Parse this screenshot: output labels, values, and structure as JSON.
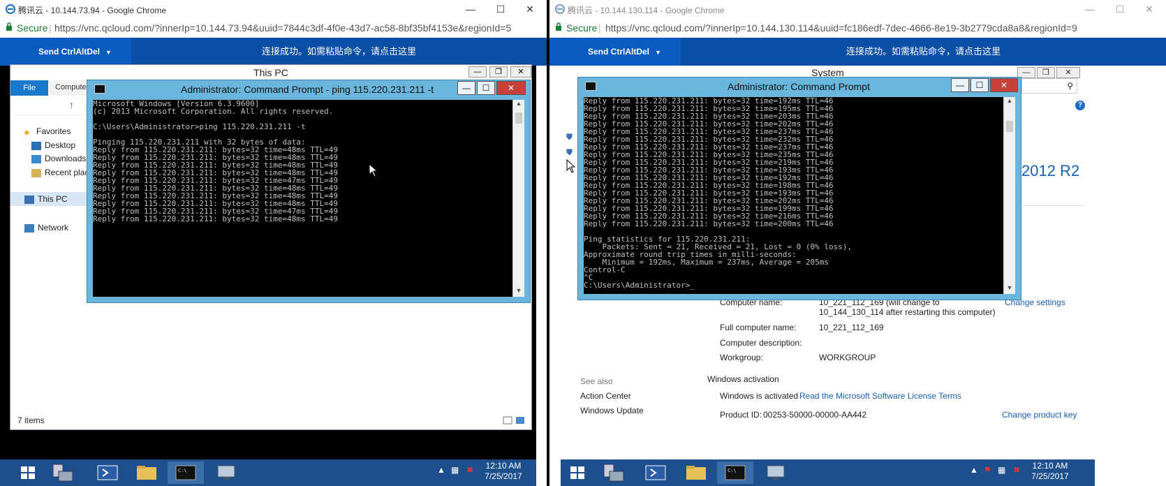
{
  "left": {
    "chrome_title": "腾讯云 - 10.144.73.94 - Google Chrome",
    "secure": "Secure",
    "url": "https://vnc.qcloud.com/?innerIp=10.144.73.94&uuid=7844c3df-4f0e-43d7-ac58-8bf35bf4153e&regionId=5",
    "send_ctrl": "Send CtrlAltDel",
    "notice": "连接成功。如需粘贴命令，请点击这里",
    "explorer": {
      "title": "This PC",
      "tab_file": "File",
      "tab_computer": "Computer",
      "nav_items": [
        "Favorites",
        "Desktop",
        "Downloads",
        "Recent places",
        "This PC",
        "Network"
      ],
      "status": "7 items"
    },
    "cmd": {
      "title": "Administrator: Command Prompt - ping  115.220.231.211 -t",
      "lines": [
        "Microsoft Windows [Version 6.3.9600]",
        "(c) 2013 Microsoft Corporation. All rights reserved.",
        "",
        "C:\\Users\\Administrator>ping 115.220.231.211 -t",
        "",
        "Pinging 115.220.231.211 with 32 bytes of data:",
        "Reply from 115.220.231.211: bytes=32 time=48ms TTL=49",
        "Reply from 115.220.231.211: bytes=32 time=48ms TTL=49",
        "Reply from 115.220.231.211: bytes=32 time=48ms TTL=49",
        "Reply from 115.220.231.211: bytes=32 time=48ms TTL=49",
        "Reply from 115.220.231.211: bytes=32 time=47ms TTL=49",
        "Reply from 115.220.231.211: bytes=32 time=48ms TTL=49",
        "Reply from 115.220.231.211: bytes=32 time=48ms TTL=49",
        "Reply from 115.220.231.211: bytes=32 time=48ms TTL=49",
        "Reply from 115.220.231.211: bytes=32 time=47ms TTL=49",
        "Reply from 115.220.231.211: bytes=32 time=48ms TTL=49"
      ]
    },
    "clock": {
      "time": "12:10 AM",
      "date": "7/25/2017"
    }
  },
  "right": {
    "chrome_title": "腾讯云 - 10.144.130.114 - Google Chrome",
    "secure": "Secure",
    "url": "https://vnc.qcloud.com/?innerIp=10.144.130.114&uuid=fc186edf-7dec-4666-8e19-3b2779cda8a8&regionId=9",
    "send_ctrl": "Send CtrlAltDel",
    "notice": "连接成功。如需粘贴命令，请点击这里",
    "system_title": "System",
    "os_brand": "2012 R2",
    "cmd": {
      "title": "Administrator: Command Prompt",
      "lines": [
        "Reply from 115.220.231.211: bytes=32 time=192ms TTL=46",
        "Reply from 115.220.231.211: bytes=32 time=195ms TTL=46",
        "Reply from 115.220.231.211: bytes=32 time=203ms TTL=46",
        "Reply from 115.220.231.211: bytes=32 time=202ms TTL=46",
        "Reply from 115.220.231.211: bytes=32 time=237ms TTL=46",
        "Reply from 115.220.231.211: bytes=32 time=232ms TTL=46",
        "Reply from 115.220.231.211: bytes=32 time=237ms TTL=46",
        "Reply from 115.220.231.211: bytes=32 time=235ms TTL=46",
        "Reply from 115.220.231.211: bytes=32 time=219ms TTL=46",
        "Reply from 115.220.231.211: bytes=32 time=193ms TTL=46",
        "Reply from 115.220.231.211: bytes=32 time=192ms TTL=46",
        "Reply from 115.220.231.211: bytes=32 time=198ms TTL=46",
        "Reply from 115.220.231.211: bytes=32 time=193ms TTL=46",
        "Reply from 115.220.231.211: bytes=32 time=202ms TTL=46",
        "Reply from 115.220.231.211: bytes=32 time=199ms TTL=46",
        "Reply from 115.220.231.211: bytes=32 time=216ms TTL=46",
        "Reply from 115.220.231.211: bytes=32 time=200ms TTL=46",
        "",
        "Ping statistics for 115.220.231.211:",
        "    Packets: Sent = 21, Received = 21, Lost = 0 (0% loss),",
        "Approximate round trip times in milli-seconds:",
        "    Minimum = 192ms, Maximum = 237ms, Average = 205ms",
        "Control-C",
        "^C",
        "C:\\Users\\Administrator>_"
      ]
    },
    "system": {
      "computer_name_label": "Computer name:",
      "computer_name_value": "10_221_112_169 (will change to 10_144_130_114 after restarting this computer)",
      "change_settings": "Change settings",
      "full_name_label": "Full computer name:",
      "full_name_value": "10_221_112_169",
      "desc_label": "Computer description:",
      "workgroup_label": "Workgroup:",
      "workgroup_value": "WORKGROUP",
      "see_also": "See also",
      "action_center": "Action Center",
      "windows_update": "Windows Update",
      "activation_heading": "Windows activation",
      "activated": "Windows is activated",
      "license_link": "Read the Microsoft Software License Terms",
      "product_id_label": "Product ID:",
      "product_id_value": "00253-50000-00000-AA442",
      "change_key": "Change product key"
    },
    "clock": {
      "time": "12:10 AM",
      "date": "7/25/2017"
    }
  },
  "colors": {
    "vnc_bar": "#0a4ea5",
    "cmd_border": "#6bb6dc",
    "taskbar": "#1c4f8c",
    "link": "#1a5fb4"
  }
}
